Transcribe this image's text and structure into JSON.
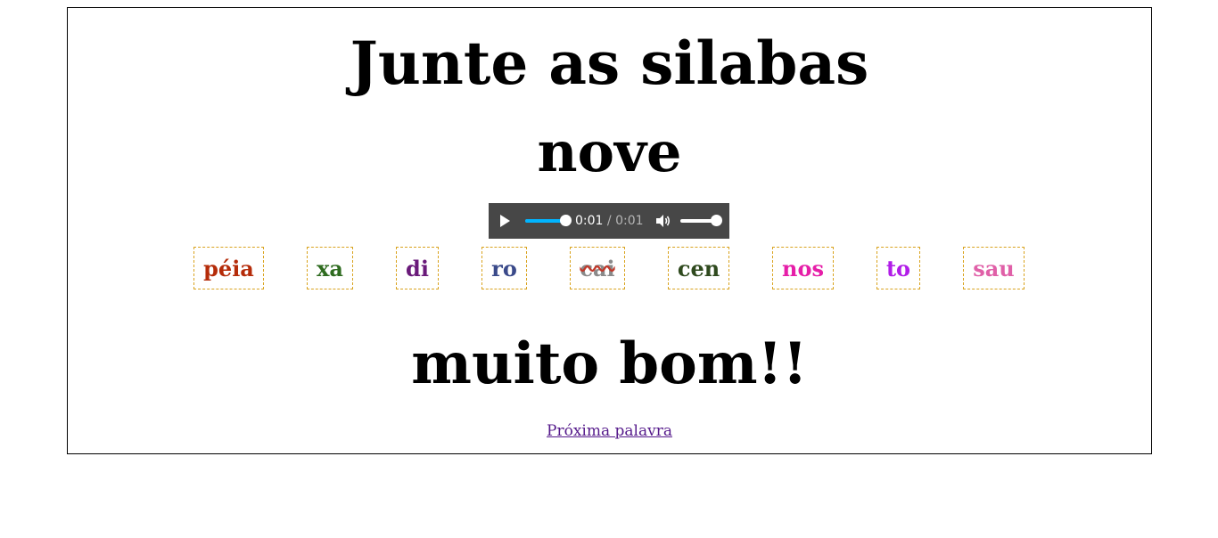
{
  "title": "Junte as silabas",
  "target_word": "nove",
  "audio": {
    "current_time": "0:01",
    "separator": "/",
    "duration": "0:01",
    "progress_fraction": 1.0,
    "volume_fraction": 1.0,
    "accent_color": "#00b4ff",
    "background_color": "#474747"
  },
  "syllables": [
    {
      "text": "péia",
      "color": "#b52c0a"
    },
    {
      "text": "xa",
      "color": "#2e6b1f"
    },
    {
      "text": "di",
      "color": "#6a1a7a"
    },
    {
      "text": "ro",
      "color": "#3a4a8a"
    },
    {
      "text": "cai",
      "color": "#8a8a8a",
      "struck": true
    },
    {
      "text": "cen",
      "color": "#2f4a1e"
    },
    {
      "text": "nos",
      "color": "#e61ea8"
    },
    {
      "text": "to",
      "color": "#b11de8"
    },
    {
      "text": "sau",
      "color": "#e060a8"
    }
  ],
  "result_message": "muito bom!!",
  "next_link": "Próxima palavra"
}
